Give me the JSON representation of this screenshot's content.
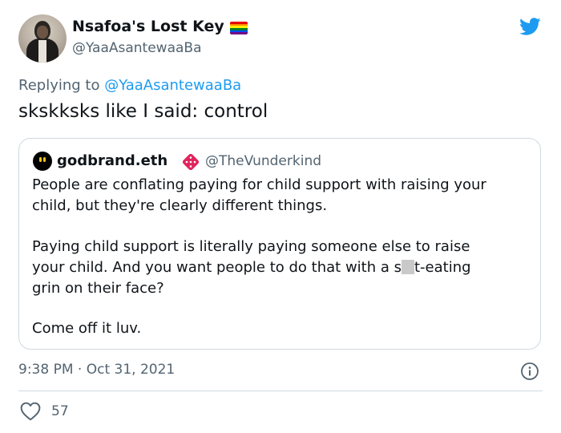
{
  "author": {
    "display_name": "Nsafoa's Lost Key",
    "handle": "@YaaAsantewaaBa",
    "flag_colors": [
      "#e40303",
      "#ff8c00",
      "#ffed00",
      "#008026",
      "#004dff",
      "#750787"
    ]
  },
  "reply": {
    "prefix": "Replying to ",
    "mention": "@YaaAsantewaaBa"
  },
  "tweet": {
    "text": "skskksks like I said: control"
  },
  "quote": {
    "author_name": "godbrand.eth",
    "author_handle": "@TheVunderkind",
    "badge_icon": "dice-icon",
    "paragraphs": {
      "p1_line1": "People are conflating paying for child support with raising your",
      "p1_line2": "child, but they're clearly different things.",
      "p2_line1": "Paying child support is literally paying someone else to raise",
      "p2_line2_before": "your child. And you want people to do that with a s",
      "p2_line2_after": "t-eating",
      "p2_line3": "grin on their face?",
      "p3": "Come off it luv."
    }
  },
  "meta": {
    "time": "9:38 PM",
    "separator": "·",
    "date": "Oct 31, 2021"
  },
  "stats": {
    "likes": "57"
  },
  "colors": {
    "accent": "#1d9bf0",
    "secondary_text": "#536471",
    "border": "#cfd9de",
    "dice": "#e0245e"
  },
  "icons": {
    "brand": "twitter-bird-icon",
    "info": "info-icon",
    "like": "heart-icon"
  }
}
